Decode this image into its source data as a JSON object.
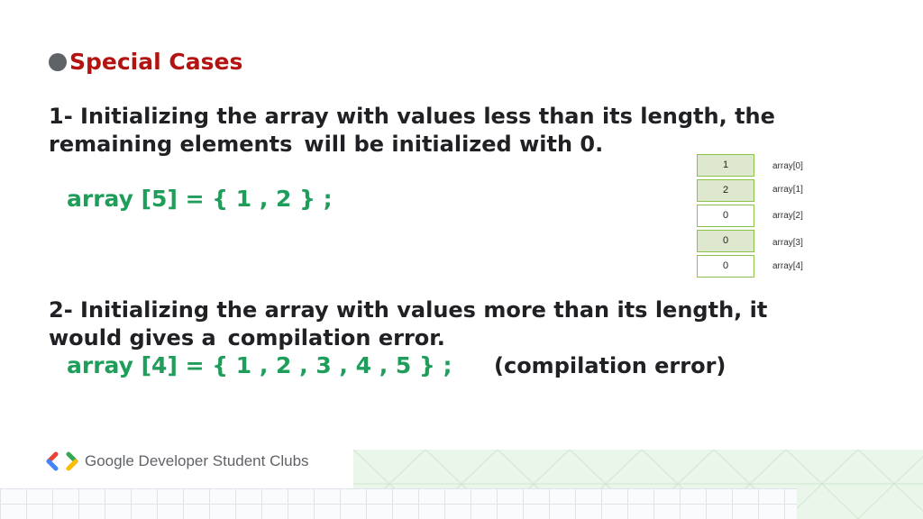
{
  "heading": "Special Cases",
  "point1": {
    "line1": "1- Initializing the array with values less than its length, the",
    "line2a": "remaining elements",
    "line2b": "will be initialized with 0."
  },
  "code1": "array [5] = { 1 , 2 } ;",
  "array_diagram": {
    "cells": [
      {
        "value": "1",
        "label": "array[0]"
      },
      {
        "value": "2",
        "label": "array[1]"
      },
      {
        "value": "0",
        "label": "array[2]"
      },
      {
        "value": "0",
        "label": "array[3]"
      },
      {
        "value": "0",
        "label": "array[4]"
      }
    ]
  },
  "point2": {
    "line1": "2- Initializing the array with values more than its length, it",
    "line2a": "would gives a",
    "line2b": "compilation error."
  },
  "code2": "array [4] = { 1 , 2 , 3 , 4 , 5 } ;",
  "note": "(compilation error)",
  "footer": {
    "brand": "Google Developer Student Clubs"
  },
  "colors": {
    "heading": "#b31412",
    "code": "#1e9e5a",
    "text": "#202124",
    "bullet": "#5f6368"
  }
}
